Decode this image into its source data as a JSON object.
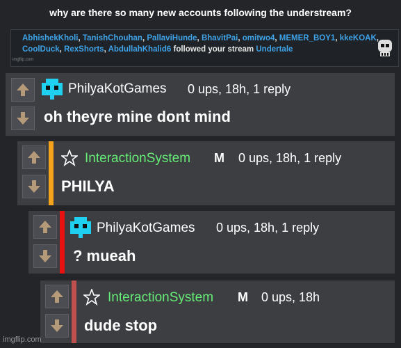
{
  "header": {
    "title": "why are there so many new accounts following the understream?"
  },
  "notification": {
    "users": [
      "AbhishekKholi",
      "TanishChouhan",
      "PallaviHunde",
      "BhavitPai",
      "omitwo4",
      "MEMER_BOY1",
      "kkeKOAK",
      "CoolDuck",
      "RexShorts",
      "AbdullahKhalid6"
    ],
    "message": "followed your stream",
    "stream": "Undertale",
    "watermark": "imgflip.com"
  },
  "comments": [
    {
      "username": "PhilyaKotGames",
      "meta": "0 ups, 18h, 1 reply",
      "text": "oh theyre mine dont mind",
      "mod": "",
      "bar_color": ""
    },
    {
      "username": "InteractionSystem",
      "meta": "0 ups, 18h, 1 reply",
      "text": "PHILYA",
      "mod": "M",
      "bar_color": "#f5a31a"
    },
    {
      "username": "PhilyaKotGames",
      "meta": "0 ups, 18h, 1 reply",
      "text": "? mueah",
      "mod": "",
      "bar_color": "#e81010"
    },
    {
      "username": "InteractionSystem",
      "meta": "0 ups, 18h",
      "text": "dude stop",
      "mod": "M",
      "bar_color": "#c05050"
    }
  ],
  "footer": {
    "watermark": "imgflip.com"
  },
  "colors": {
    "background": "#232528",
    "panel": "#3c3e42",
    "link": "#3ea3e8",
    "mod_name": "#66ee77"
  }
}
